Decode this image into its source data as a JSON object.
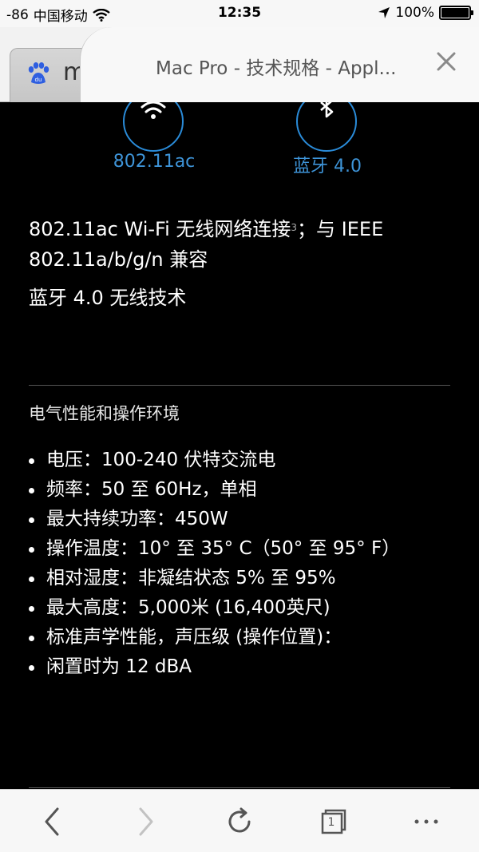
{
  "status_bar": {
    "signal": "-86",
    "carrier": "中国移动",
    "time": "12:35",
    "battery": "100%",
    "battery_level": 1.0
  },
  "tabs": {
    "background_label": "m",
    "active_title": "Mac Pro - 技术规格 - Appl..."
  },
  "connectivity": {
    "wifi_label": "802.11ac",
    "bluetooth_label": "蓝牙 4.0",
    "wifi_desc_line1": "802.11ac Wi-Fi 无线网络连接",
    "wifi_footnote": "3",
    "wifi_desc_line1_end": "；与 IEEE",
    "wifi_desc_line2": "802.11a/b/g/n 兼容",
    "bluetooth_desc": "蓝牙 4.0 无线技术"
  },
  "electrical": {
    "title": "电气性能和操作环境",
    "items": [
      "电压：100-240 伏特交流电",
      "频率：50 至 60Hz，单相",
      "最大持续功率：450W",
      "操作温度：10° 至 35° C（50° 至 95° F）",
      "相对湿度：非凝结状态 5% 至 95%",
      "最大高度：5,000米 (16,400英尺)",
      "标准声学性能，声压级 (操作位置)：",
      "闲置时为 12 dBA"
    ]
  },
  "toolbar": {
    "tab_count": "1"
  },
  "colors": {
    "accent_blue": "#2a8bd8",
    "background": "#000000"
  }
}
